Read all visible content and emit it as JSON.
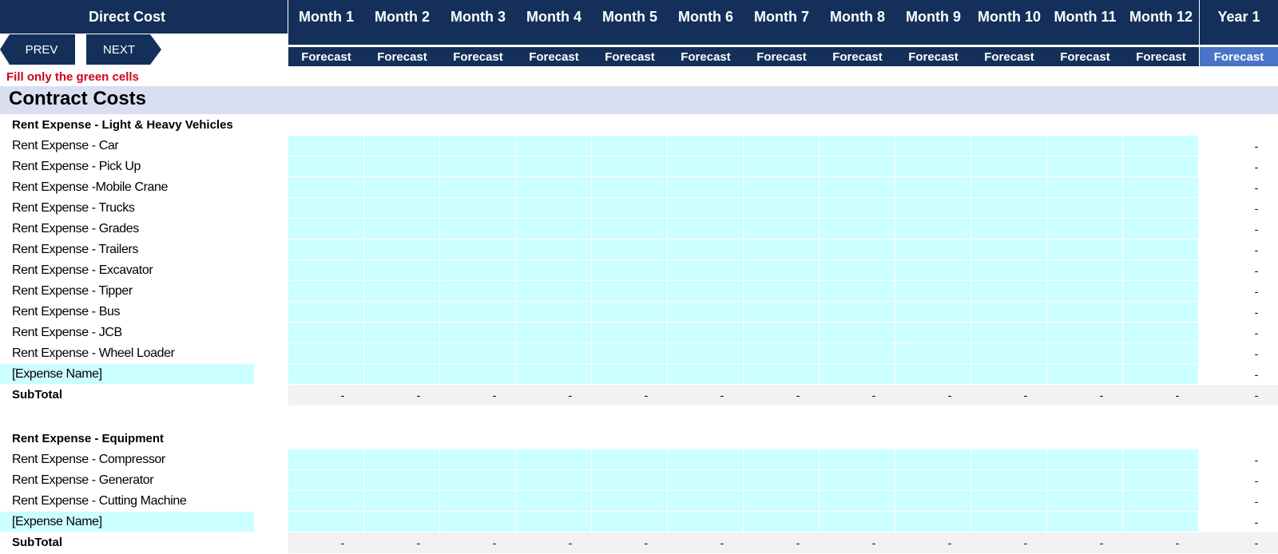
{
  "header": {
    "title": "Direct Cost",
    "columns": [
      "Month 1",
      "Month 2",
      "Month 3",
      "Month 4",
      "Month 5",
      "Month 6",
      "Month 7",
      "Month 8",
      "Month 9",
      "Month 10",
      "Month 11",
      "Month 12",
      "Year 1"
    ],
    "subheaders": [
      "Forecast",
      "Forecast",
      "Forecast",
      "Forecast",
      "Forecast",
      "Forecast",
      "Forecast",
      "Forecast",
      "Forecast",
      "Forecast",
      "Forecast",
      "Forecast",
      "Forecast"
    ]
  },
  "nav": {
    "prev": "PREV",
    "next": "NEXT"
  },
  "note": "Fill only the green cells",
  "colors": {
    "header_bg": "#14305a",
    "year_fc_bg": "#4a74c8",
    "input_cell": "#ccffff",
    "section_band": "#d9dff0",
    "note_text": "#d0021b"
  },
  "section": {
    "title": "Contract Costs",
    "groups": [
      {
        "heading": "Rent Expense - Light & Heavy Vehicles",
        "rows": [
          {
            "label": "Rent Expense - Car",
            "year": "-"
          },
          {
            "label": "Rent Expense - Pick Up",
            "year": "-"
          },
          {
            "label": "Rent Expense -Mobile Crane",
            "year": "-"
          },
          {
            "label": "Rent Expense - Trucks",
            "year": "-"
          },
          {
            "label": "Rent Expense - Grades",
            "year": "-"
          },
          {
            "label": "Rent Expense - Trailers",
            "year": "-"
          },
          {
            "label": "Rent Expense - Excavator",
            "year": "-"
          },
          {
            "label": "Rent Expense - Tipper",
            "year": "-"
          },
          {
            "label": "Rent Expense - Bus",
            "year": "-"
          },
          {
            "label": "Rent Expense - JCB",
            "year": "-"
          },
          {
            "label": "Rent Expense - Wheel Loader",
            "year": "-"
          },
          {
            "label": "[Expense Name]",
            "year": "-",
            "editable_name": true
          }
        ],
        "subtotal": {
          "label": "SubTotal",
          "values": [
            "-",
            "-",
            "-",
            "-",
            "-",
            "-",
            "-",
            "-",
            "-",
            "-",
            "-",
            "-",
            "-"
          ]
        }
      },
      {
        "heading": "Rent Expense - Equipment",
        "rows": [
          {
            "label": "Rent Expense - Compressor",
            "year": "-"
          },
          {
            "label": "Rent Expense - Generator",
            "year": "-"
          },
          {
            "label": "Rent Expense - Cutting Machine",
            "year": "-"
          },
          {
            "label": "[Expense Name]",
            "year": "-",
            "editable_name": true
          }
        ],
        "subtotal": {
          "label": "SubTotal",
          "values": [
            "-",
            "-",
            "-",
            "-",
            "-",
            "-",
            "-",
            "-",
            "-",
            "-",
            "-",
            "-",
            "-"
          ]
        }
      }
    ]
  }
}
